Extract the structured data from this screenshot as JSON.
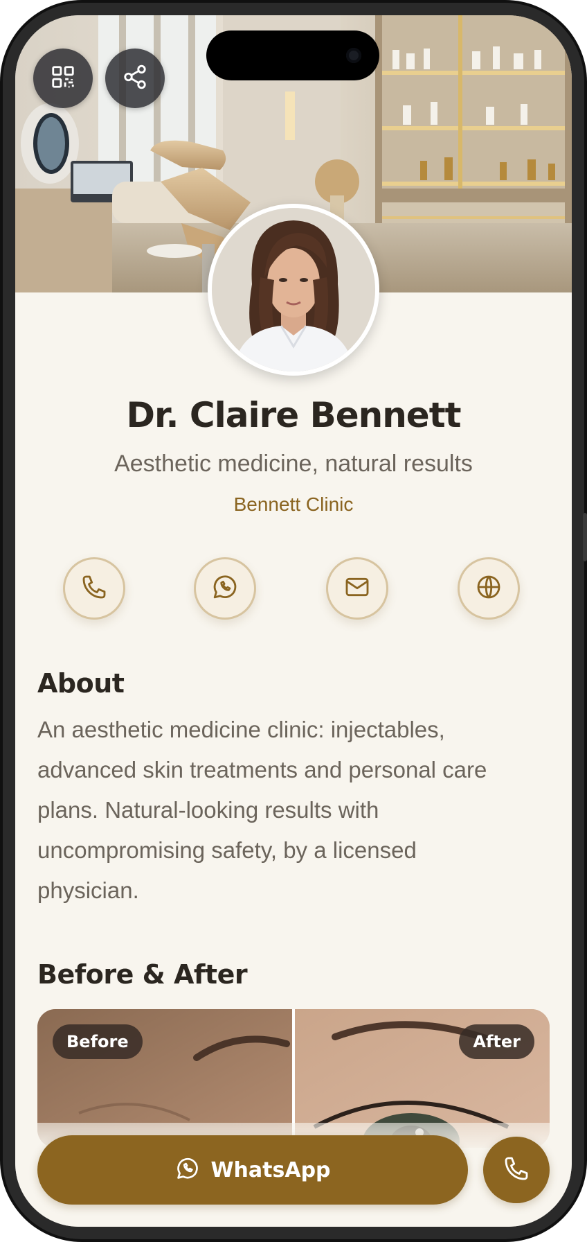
{
  "profile": {
    "name": "Dr. Claire Bennett",
    "tagline": "Aesthetic medicine, natural results",
    "clinic": "Bennett Clinic"
  },
  "header": {
    "qr_icon": "qr-code-icon",
    "share_icon": "share-icon"
  },
  "contacts": [
    {
      "id": "phone",
      "icon": "phone-icon"
    },
    {
      "id": "whatsapp",
      "icon": "whatsapp-icon"
    },
    {
      "id": "email",
      "icon": "mail-icon"
    },
    {
      "id": "website",
      "icon": "globe-icon"
    }
  ],
  "about": {
    "title": "About",
    "text": "An aesthetic medicine clinic: injectables, advanced skin treatments and personal care plans. Natural-looking results with uncompromising safety, by a licensed physician."
  },
  "before_after": {
    "title": "Before & After",
    "before_label": "Before",
    "after_label": "After"
  },
  "actions": {
    "whatsapp_label": "WhatsApp",
    "call_icon": "phone-icon"
  },
  "colors": {
    "accent": "#8c6520",
    "background": "#f8f5ee",
    "clinic_text": "#8a6420",
    "heading": "#2b2620",
    "body_text": "#6b645b"
  }
}
